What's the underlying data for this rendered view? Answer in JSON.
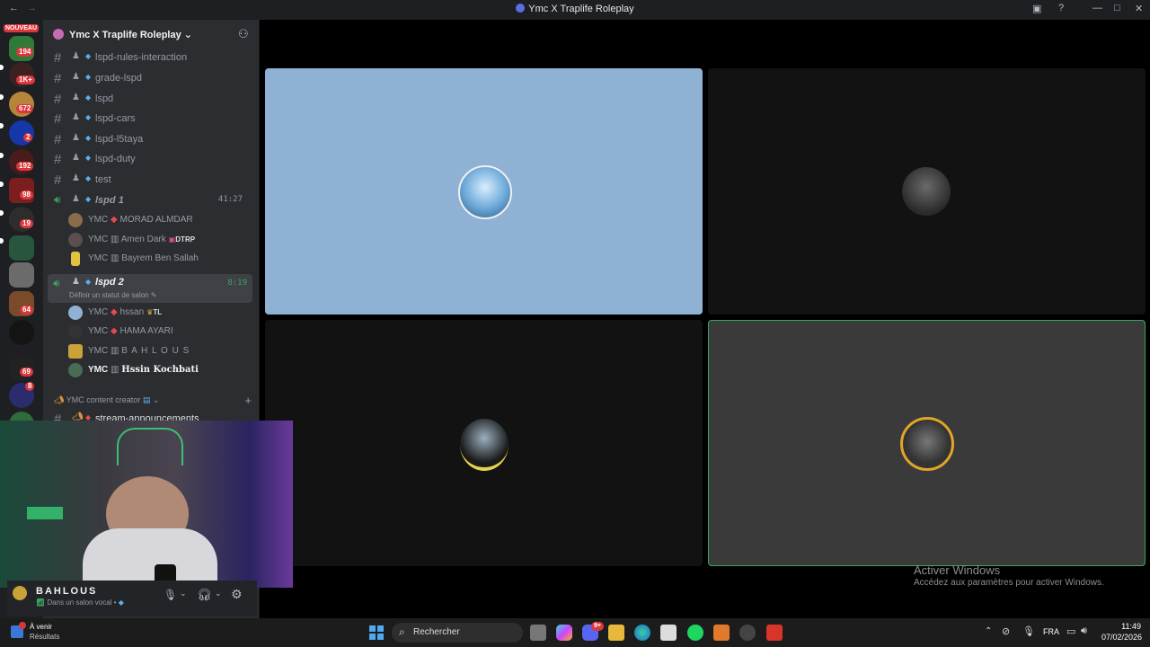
{
  "window": {
    "title": "Ymc X Traplife Roleplay"
  },
  "rail": {
    "new_badge": "NOUVEAU",
    "badges": [
      "194",
      "1K+",
      "672",
      "2",
      "192",
      "98",
      "19",
      "64",
      "69",
      "8"
    ]
  },
  "server": {
    "name": "Ymc X Traplife Roleplay"
  },
  "channels": [
    {
      "name": "lspd-rules-interaction"
    },
    {
      "name": "grade-lspd"
    },
    {
      "name": "lspd"
    },
    {
      "name": "lspd-cars"
    },
    {
      "name": "lspd-l5taya"
    },
    {
      "name": "lspd-duty"
    },
    {
      "name": "test"
    }
  ],
  "voice1": {
    "name": "lspd",
    "number": "1",
    "timer": "41:27",
    "users": [
      {
        "prefix": "YMC",
        "sep": "◆",
        "name": "MORAD ALMDAR"
      },
      {
        "prefix": "YMC",
        "sep": "▥",
        "name": "Amen Dark",
        "tag": "DTRP"
      },
      {
        "prefix": "YMC",
        "sep": "▥",
        "name": "Bayrem Ben Sallah"
      }
    ]
  },
  "voice2": {
    "name": "lspd",
    "number": "2",
    "timer": "8:19",
    "status_hint": "Définir un statut de salon",
    "users": [
      {
        "prefix": "YMC",
        "sep": "◆",
        "name": "hssan",
        "tag": "TL"
      },
      {
        "prefix": "YMC",
        "sep": "◆",
        "name": "HAMA AYARI"
      },
      {
        "prefix": "YMC",
        "sep": "▥",
        "name": "B A H L O U S"
      },
      {
        "prefix": "YMC",
        "sep": "▥",
        "name": "Hssin Kochbati"
      }
    ]
  },
  "category": {
    "name": "YMC content creator"
  },
  "cut_channel": {
    "name": "stream-announcements"
  },
  "userbar": {
    "name": "BAHLOUS",
    "status": "Dans un salon vocal"
  },
  "watermark": {
    "title": "Activer Windows",
    "subtitle": "Accédez aux paramètres pour activer Windows."
  },
  "taskbar": {
    "weather_title": "À venir",
    "weather_sub": "Résultats",
    "search_placeholder": "Rechercher",
    "discord_badge": "9+",
    "language": "FRA",
    "time": "11:49",
    "date": "07/02/2026"
  },
  "colors": {
    "accent_speaking": "#3ba55d",
    "badge_red": "#da373c",
    "tile_blue": "#8fb1d3"
  }
}
